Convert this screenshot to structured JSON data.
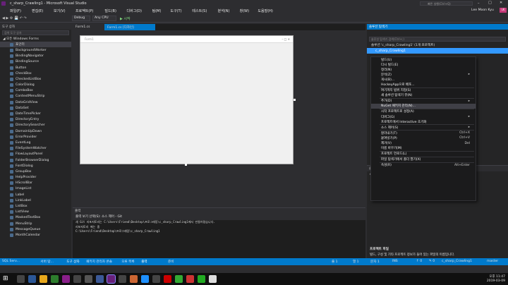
{
  "window": {
    "title": "c_sharp_Crawling1 - Microsoft Visual Studio",
    "quicklaunch": "빠른 실행(Ctrl+Q)",
    "user": "Lee Moon Kyu",
    "user_initials": "LK"
  },
  "menu": [
    "파일(F)",
    "편집(E)",
    "보기(V)",
    "프로젝트(P)",
    "빌드(B)",
    "디버그(D)",
    "팀(M)",
    "도구(T)",
    "테스트(S)",
    "분석(N)",
    "창(W)",
    "도움말(H)"
  ],
  "toolbar": {
    "config": "Debug",
    "platform": "Any CPU",
    "start": "▶ 시작"
  },
  "toolbox": {
    "title": "도구 상자",
    "search": "검색 도구 상자",
    "category": "◢ 모든 Windows Forms",
    "items": [
      "포인터",
      "BackgroundWorker",
      "BindingNavigator",
      "BindingSource",
      "Button",
      "CheckBox",
      "CheckedListBox",
      "ColorDialog",
      "ComboBox",
      "ContextMenuStrip",
      "DataGridView",
      "DataSet",
      "DateTimePicker",
      "DirectoryEntry",
      "DirectorySearcher",
      "DomainUpDown",
      "ErrorProvider",
      "EventLog",
      "FileSystemWatcher",
      "FlowLayoutPanel",
      "FolderBrowserDialog",
      "FontDialog",
      "GroupBox",
      "HelpProvider",
      "HScrollBar",
      "ImageList",
      "Label",
      "LinkLabel",
      "ListBox",
      "ListView",
      "MaskedTextBox",
      "MenuStrip",
      "MessageQueue",
      "MonthCalendar"
    ]
  },
  "editor": {
    "tab1": "Form1.cs",
    "tab2": "Form1.cs [디자인]",
    "form_title": "Form1"
  },
  "output": {
    "title": "출력",
    "source_label": "출력 보기 선택(S): 소스 제어 - Git",
    "lines": [
      "새 Git 리포지토리는 C:\\Users\\Friend\\Desktop\\프로그래밍\\c_sharp_Crawling1에서 만들어졌습니다.",
      "리포지토리 에는 중",
      "C:\\Users\\Friend\\Desktop\\프로그래밍\\c_sharp_Crawling1"
    ]
  },
  "solution": {
    "title": "솔루션 탐색기",
    "search": "솔루션 탐색기 검색(Ctrl+;)",
    "root": "솔루션 'c_sharp_Crawling1' (1개 프로젝트)",
    "project": "c_sharp_Crawling1"
  },
  "context_menu": [
    {
      "label": "빌드(U)",
      "shortcut": ""
    },
    {
      "label": "다시 빌드(E)",
      "shortcut": ""
    },
    {
      "label": "정리(N)",
      "shortcut": ""
    },
    {
      "label": "분석(Z)",
      "shortcut": "▸"
    },
    {
      "label": "게시(B)...",
      "shortcut": ""
    },
    {
      "label": "HockeyApp으로 배포...",
      "shortcut": ""
    },
    {
      "sep": true
    },
    {
      "label": "여기까지 범위 지정(S)",
      "shortcut": ""
    },
    {
      "label": "새 솔루션 탐색기 뷰(N)",
      "shortcut": ""
    },
    {
      "sep": true
    },
    {
      "label": "추가(D)",
      "shortcut": "▸"
    },
    {
      "label": "NuGet 패키지 관리(N)...",
      "shortcut": "",
      "hl": true
    },
    {
      "sep": true
    },
    {
      "label": "시작 프로젝트로 설정(A)",
      "shortcut": ""
    },
    {
      "label": "디버그(G)",
      "shortcut": "▸"
    },
    {
      "label": "프로젝트에서 Interactive 초기화",
      "shortcut": ""
    },
    {
      "sep": true
    },
    {
      "label": "소스 제어(S)",
      "shortcut": "▸"
    },
    {
      "sep": true
    },
    {
      "label": "잘라내기(T)",
      "shortcut": "Ctrl+X"
    },
    {
      "label": "붙여넣기(P)",
      "shortcut": "Ctrl+V"
    },
    {
      "label": "제거(V)",
      "shortcut": "Del"
    },
    {
      "label": "이름 바꾸기(M)",
      "shortcut": ""
    },
    {
      "sep": true
    },
    {
      "label": "프로젝트 언로드(L)",
      "shortcut": ""
    },
    {
      "sep": true
    },
    {
      "label": "파일 탐색기에서 폴더 열기(X)",
      "shortcut": ""
    },
    {
      "sep": true
    },
    {
      "label": "속성(R)",
      "shortcut": "Alt+Enter"
    }
  ],
  "props": {
    "title": "솔루션 탐색기",
    "name": "c_sharp",
    "desc_title": "프로젝트 파일",
    "desc": "빌드, 구성 및 기타 프로젝트 정보가 들어 있는 파일의 이름입니다."
  },
  "status": {
    "left": "준비",
    "line": "줄 1",
    "col": "열 1",
    "char": "문자 1",
    "ins": "INS",
    "add": "↑ 0",
    "pen": "✎ 0",
    "repo": "c_sharp_Crawling1",
    "branch": "master"
  },
  "bottom_tabs": [
    "SQL Serv...",
    "서버 탐...",
    "도구 상자",
    "패키지 관리자 콘솔",
    "오류 목록",
    "출력"
  ],
  "clock": {
    "time": "오후 11:47",
    "date": "2019-03-09"
  },
  "colors": {
    "accent": "#007acc",
    "bg": "#2d2d30"
  }
}
